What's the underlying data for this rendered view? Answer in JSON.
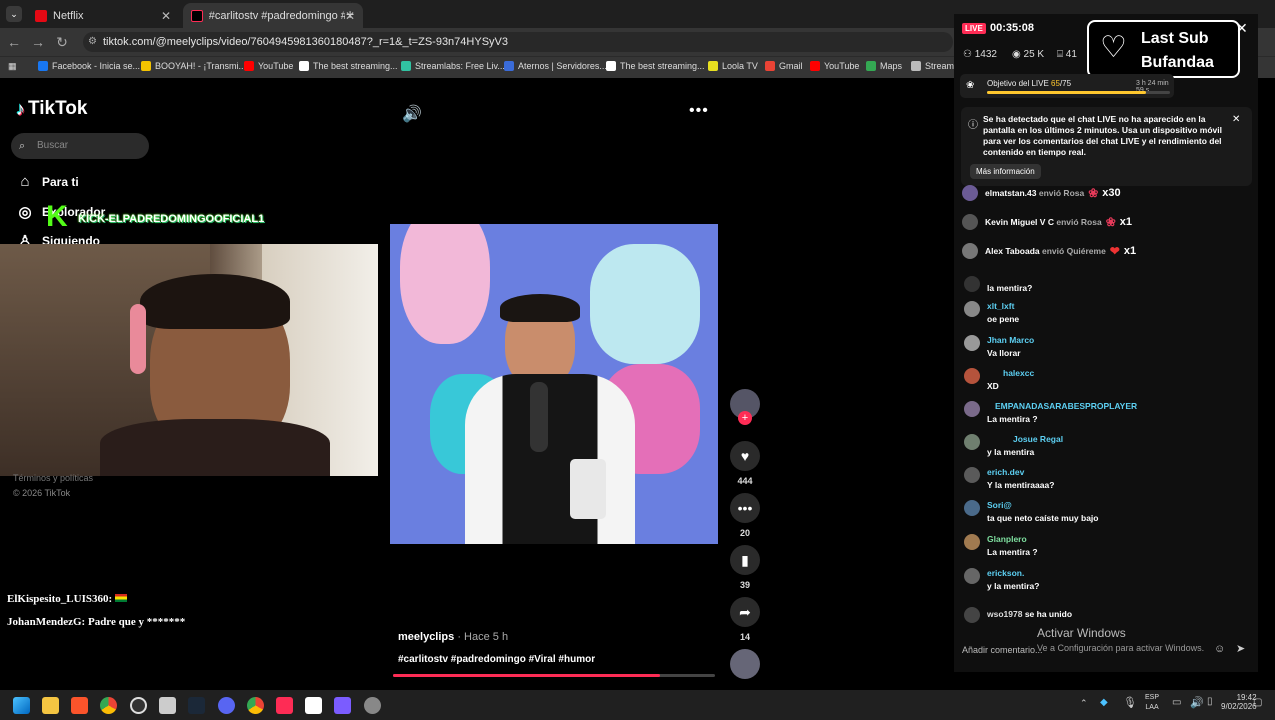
{
  "browser": {
    "tabs": [
      {
        "label": "Netflix",
        "color": "#e50914"
      },
      {
        "label": "#carlitostv #padredomingo #Vi",
        "color": "#fe2c55"
      }
    ],
    "url": "tiktok.com/@meelyclips/video/7604945981360180487?_r=1&_t=ZS-93n74HYSyV3",
    "bookmarks": [
      {
        "label": "Facebook - Inicia se...",
        "color": "#1877f2"
      },
      {
        "label": "BOOYAH! - ¡Transmi...",
        "color": "#f5c400"
      },
      {
        "label": "YouTube",
        "color": "#ff0000"
      },
      {
        "label": "The best streaming...",
        "color": "#ffffff"
      },
      {
        "label": "Streamlabs: Free Liv...",
        "color": "#31c3a2"
      },
      {
        "label": "Aternos | Servidores...",
        "color": "#3a6bd8"
      },
      {
        "label": "The best streaming...",
        "color": "#ffffff"
      },
      {
        "label": "Loola TV",
        "color": "#e8e020"
      },
      {
        "label": "Gmail",
        "color": "#ea4335"
      },
      {
        "label": "YouTube",
        "color": "#ff0000"
      },
      {
        "label": "Maps",
        "color": "#34a853"
      },
      {
        "label": "Stream",
        "color": "#bbbbbb"
      }
    ]
  },
  "tiktok": {
    "logo": "TikTok",
    "search_placeholder": "Buscar",
    "nav": [
      "Para ti",
      "Explorador",
      "Siguiendo"
    ],
    "footer_terms": "Términos y políticas",
    "copyright": "© 2026 TikTok",
    "video": {
      "author": "meelyclips",
      "time": "· Hace 5 h",
      "hashtags": "#carlitostv #padredomingo #Viral #humor",
      "likes": "444",
      "comments": "20",
      "saves": "39",
      "shares": "14",
      "progress": 0.83
    }
  },
  "overlay": {
    "kick_name": "KICK-ELPADREDOMINGOOFICIAL1",
    "chat_overlay": [
      "ElKispesito_LUIS360:",
      "JohanMendezG: Padre que y *******"
    ]
  },
  "live": {
    "badge": "LIVE",
    "time": "00:35:08",
    "viewers": "1432",
    "views": "25 K",
    "other": "41",
    "sub_alert": "Last Sub Bufandaa",
    "goal_label": "Objetivo del LIVE",
    "goal_current": "65",
    "goal_total": "/75",
    "goal_progress": 0.87,
    "goal_time": "3 h 24 min 59 s",
    "notice": "Se ha detectado que el chat LIVE no ha aparecido en la pantalla en los últimos 2 minutos. Usa un dispositivo móvil para ver los comentarios del chat LIVE y el rendimiento del contenido en tiempo real.",
    "notice_button": "Más información",
    "gifts": [
      {
        "user": "elmatstan.43",
        "action": "envió Rosa",
        "mult": "x30",
        "color": "#6b5b95"
      },
      {
        "user": "Kevin Miguel V C",
        "action": "envió Rosa",
        "mult": "x1",
        "color": "#555555"
      },
      {
        "user": "Alex Taboada",
        "action": "envió Quiéreme",
        "mult": "x1",
        "color": "#777777"
      }
    ],
    "comments": [
      {
        "user": "",
        "text": "la mentira?",
        "color": "#333333"
      },
      {
        "user": "xlt_lxft",
        "text": "oe pene",
        "color": "#888888"
      },
      {
        "user": "Jhan Marco",
        "text": "Va llorar",
        "color": "#999999"
      },
      {
        "user": "halexcc",
        "text": "XD",
        "color": "#b5533c"
      },
      {
        "user": "EMPANADASARABESPROPLAYER",
        "text": "La mentira ?",
        "color": "#7a6a8a"
      },
      {
        "user": "Josue Regal",
        "text": "y la mentira",
        "color": "#6f7f6f"
      },
      {
        "user": "erich.dev",
        "text": "Y la mentiraaaa?",
        "color": "#5a5a5a"
      },
      {
        "user": "Sori@",
        "text": "ta que neto caíste muy bajo",
        "color": "#4a6a8a"
      },
      {
        "user": "Glanplero",
        "text": "La mentira ?",
        "color": "#a07a50"
      },
      {
        "user": "erickson.",
        "text": "y la mentira?",
        "color": "#666666"
      }
    ],
    "joined_user": "wso1978",
    "joined_text": "se ha unido",
    "comment_placeholder": "Añadir comentario..."
  },
  "windows": {
    "activate_title": "Activar Windows",
    "activate_sub": "Ve a Configuración para activar Windows.",
    "lang": "ESP",
    "lang2": "LAA",
    "time": "19:42",
    "date": "9/02/2026"
  },
  "colors": {
    "accent": "#fe2c55",
    "kick": "#53fc18",
    "username": "#5dd0f3"
  }
}
